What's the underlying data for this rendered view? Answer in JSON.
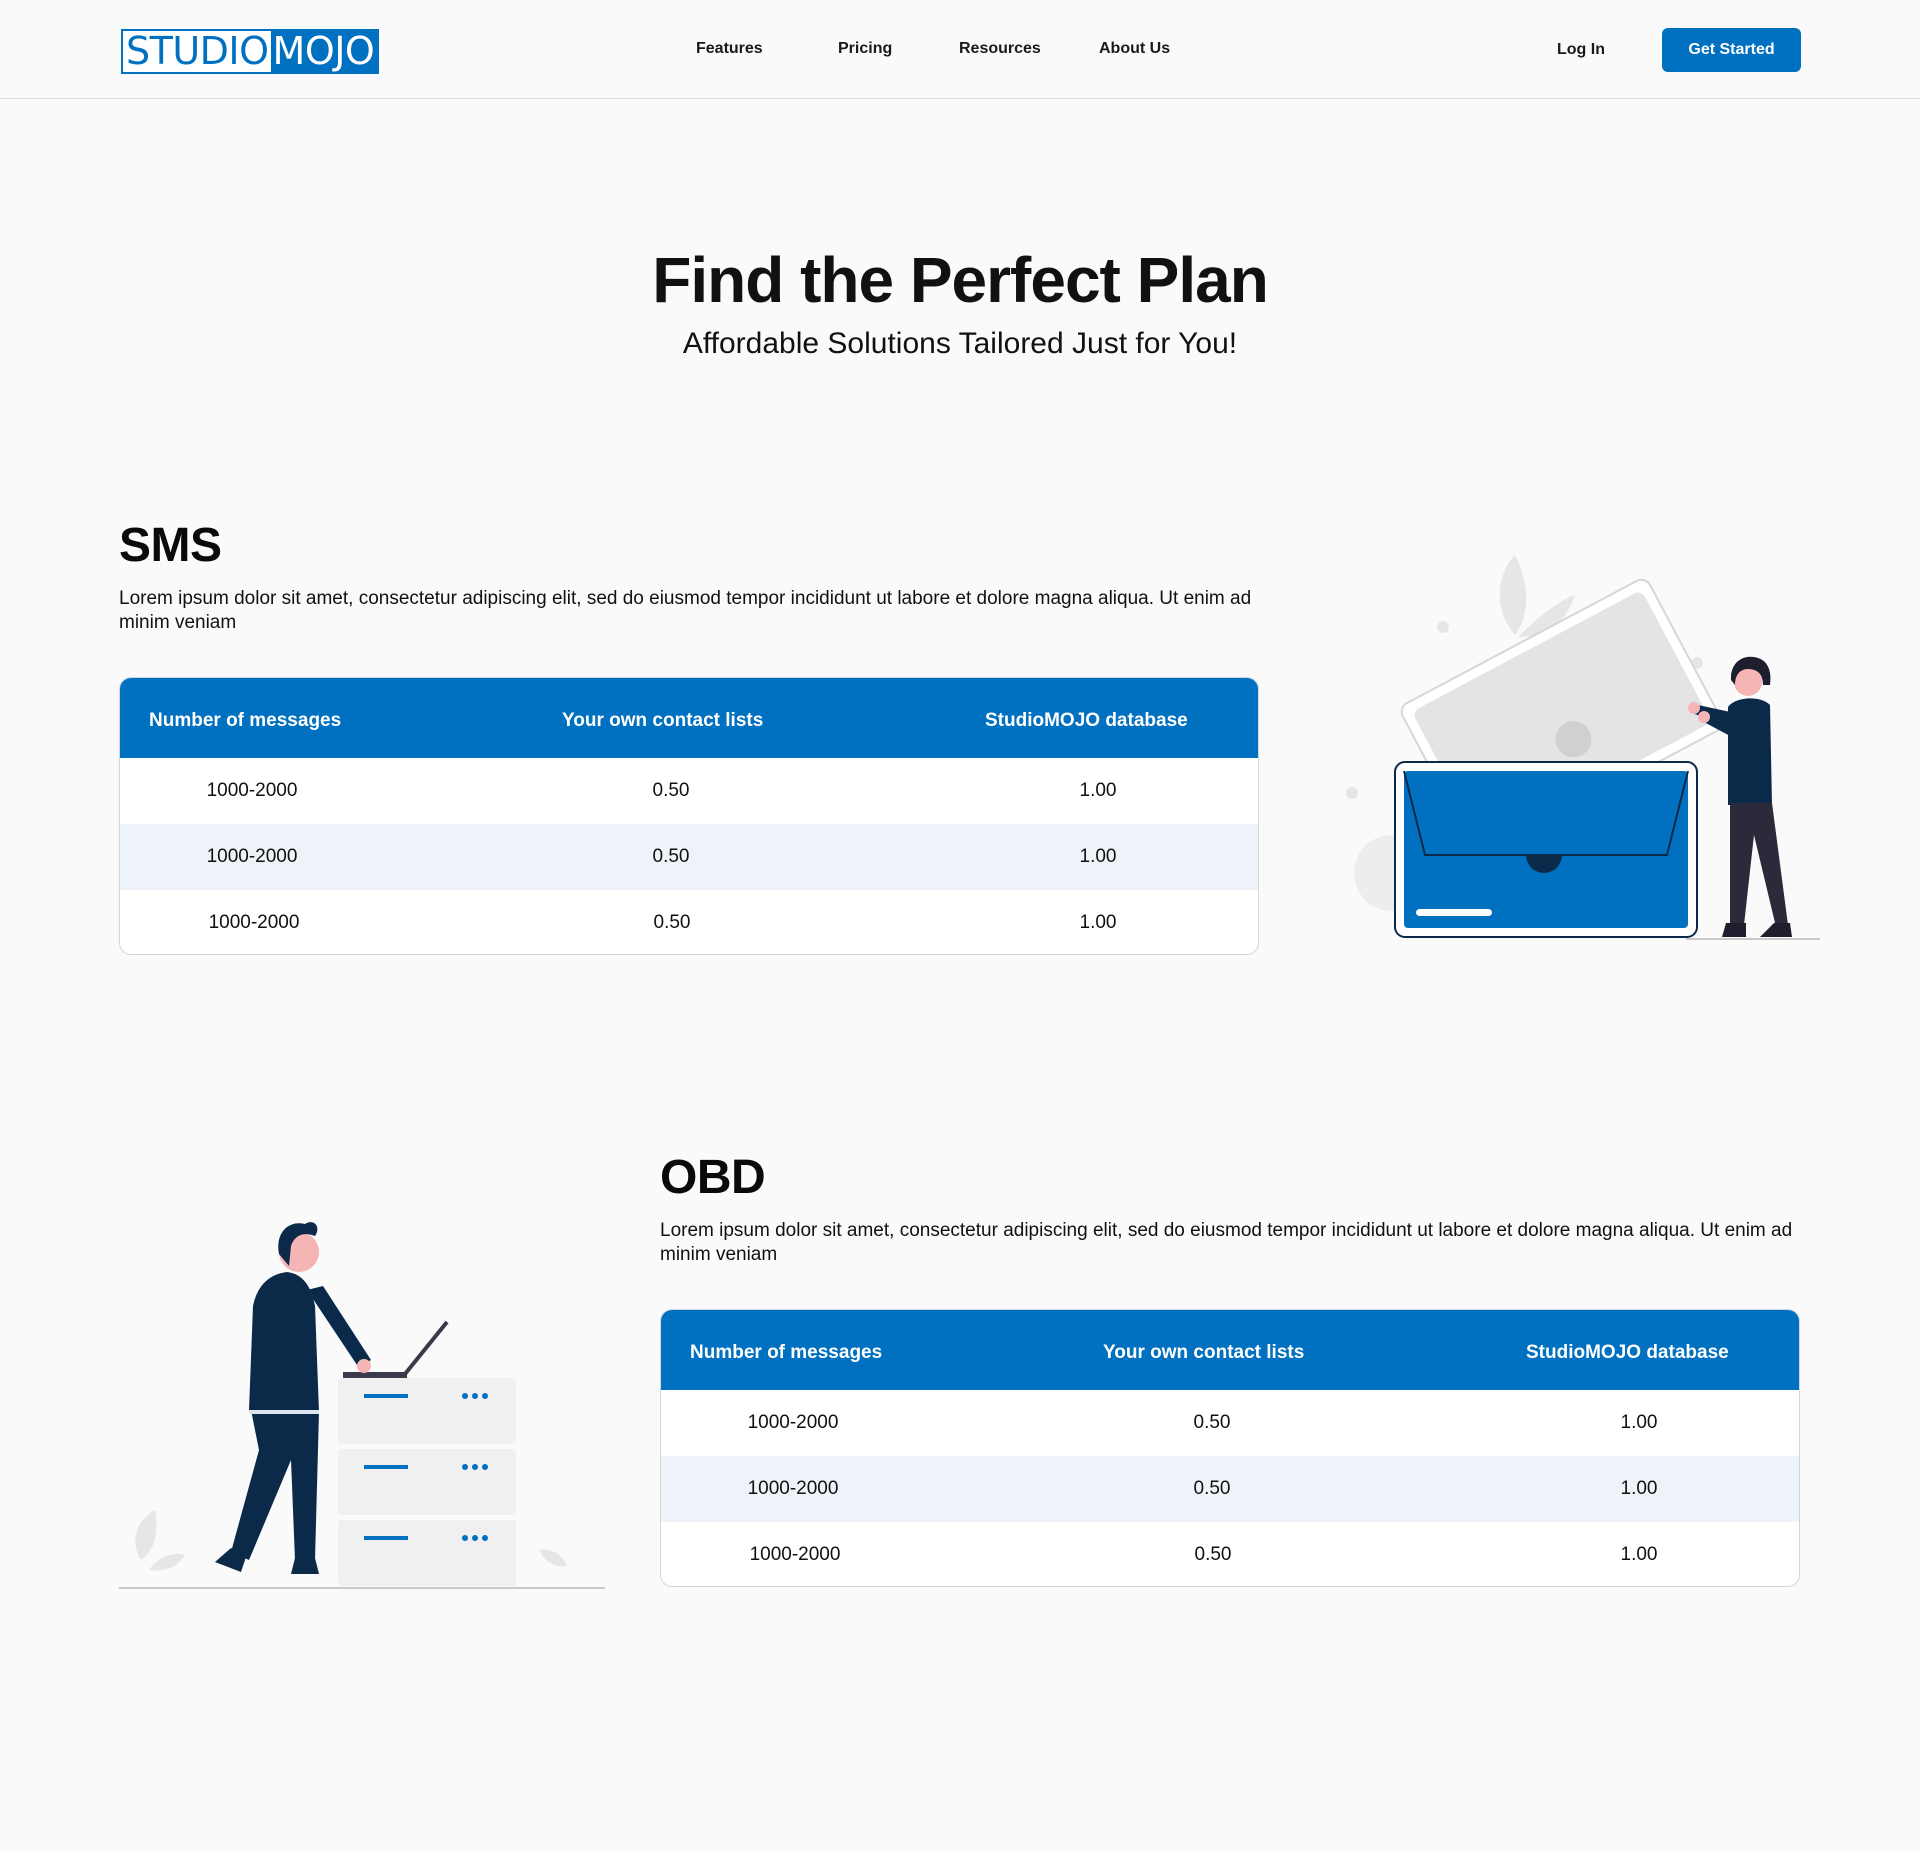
{
  "header": {
    "logo": {
      "part1": "STUDIO",
      "part2": "MOJO"
    },
    "nav": [
      "Features",
      "Pricing",
      "Resources",
      "About Us"
    ],
    "login_label": "Log In",
    "cta_label": "Get Started"
  },
  "hero": {
    "title": "Find the Perfect Plan",
    "subtitle": "Affordable Solutions Tailored Just for You!"
  },
  "sections": [
    {
      "title": "SMS",
      "description": "Lorem ipsum dolor sit amet, consectetur adipiscing elit, sed    do eiusmod tempor incididunt ut labore et dolore magna aliqua. Ut enim ad minim veniam",
      "table": {
        "headers": [
          "Number of messages",
          "Your own contact lists",
          "StudioMOJO  database"
        ],
        "rows": [
          [
            "1000-2000",
            "0.50",
            "1.00"
          ],
          [
            "1000-2000",
            "0.50",
            "1.00"
          ],
          [
            "1000-2000",
            "0.50",
            "1.00"
          ]
        ]
      }
    },
    {
      "title": "OBD",
      "description": "Lorem ipsum dolor sit amet, consectetur adipiscing elit, sed    do eiusmod tempor incididunt ut labore et dolore magna aliqua. Ut enim ad minim veniam",
      "table": {
        "headers": [
          "Number of messages",
          "Your own contact lists",
          "StudioMOJO  database"
        ],
        "rows": [
          [
            "1000-2000",
            "0.50",
            "1.00"
          ],
          [
            "1000-2000",
            "0.50",
            "1.00"
          ],
          [
            "1000-2000",
            "0.50",
            "1.00"
          ]
        ]
      }
    }
  ],
  "colors": {
    "brand": "#0070c0",
    "row_alt": "#edf3f9",
    "dark_navy": "#0b2a4a"
  }
}
